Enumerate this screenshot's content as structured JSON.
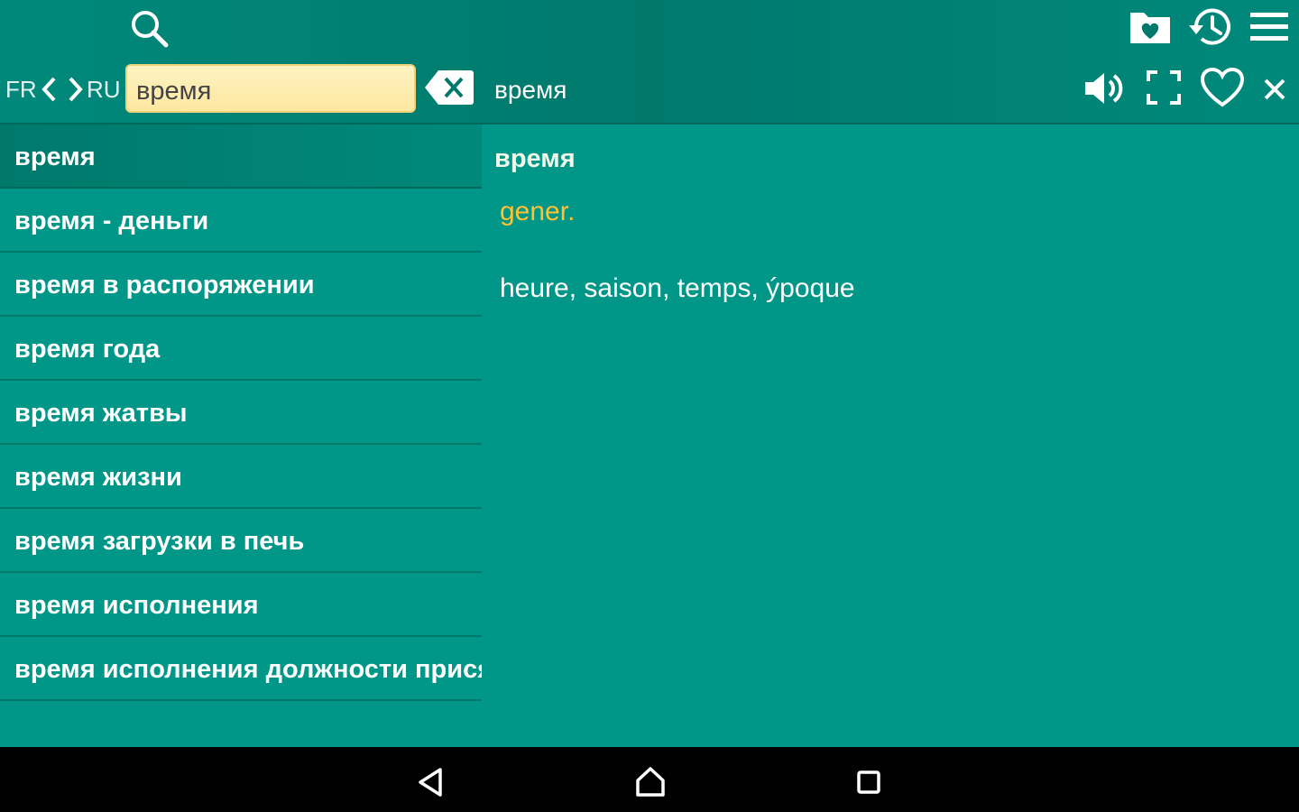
{
  "header": {
    "lang_from": "FR",
    "lang_to": "RU",
    "search_value": "время",
    "current_word": "время",
    "icons": [
      "search-icon",
      "favorites-folder-icon",
      "history-icon",
      "menu-icon",
      "speaker-icon",
      "fullscreen-icon",
      "heart-icon",
      "close-icon",
      "backspace-icon"
    ]
  },
  "word_list": {
    "items": [
      "время",
      "время - деньги",
      "время в распоряжении",
      "время года",
      "время жатвы",
      "время жизни",
      "время загрузки в печь",
      "время исполнения",
      "время исполнения должности присяжного"
    ],
    "selected_index": 0
  },
  "detail": {
    "word": "время",
    "part_of_speech": "gener.",
    "translation": "heure, saison, temps, ýpoque"
  },
  "colors": {
    "background": "#009688",
    "header": "#00796b",
    "input": "#fde7a0",
    "accent_label": "#ffc233"
  },
  "nav_bar": {
    "icons": [
      "back-icon",
      "home-icon",
      "recents-icon"
    ]
  }
}
